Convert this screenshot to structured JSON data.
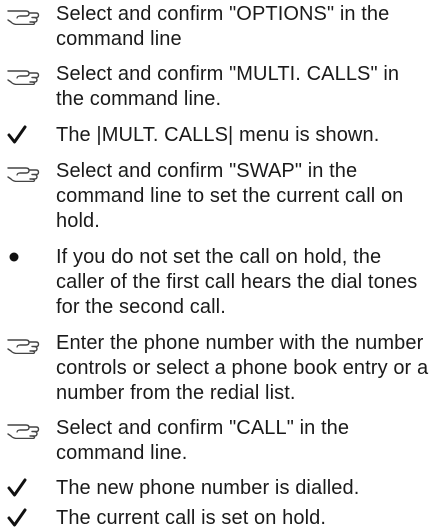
{
  "steps": [
    {
      "marker": "hand-pointer-icon",
      "text": "Select and confirm \"OPTIONS\" in the command line"
    },
    {
      "marker": "hand-pointer-icon",
      "text": "Select and confirm \"MULTI. CALLS\" in the command line."
    },
    {
      "marker": "check-icon",
      "text": "The |MULT. CALLS| menu is shown."
    },
    {
      "marker": "hand-pointer-icon",
      "text": "Select and confirm \"SWAP\" in the command line to set the current call on hold."
    },
    {
      "marker": "bullet-icon",
      "text": "If you do not set the call on hold, the caller of the first call hears the dial tones for the second call."
    },
    {
      "marker": "hand-pointer-icon",
      "text": "Enter the phone number with the number controls or select a phone book entry or a number from the redial list."
    },
    {
      "marker": "hand-pointer-icon",
      "text": "Select and confirm \"CALL\" in the command line."
    },
    {
      "marker": "check-icon",
      "text": "The new phone number is dialled."
    },
    {
      "marker": "check-icon",
      "text": "The current call is set on hold."
    }
  ]
}
